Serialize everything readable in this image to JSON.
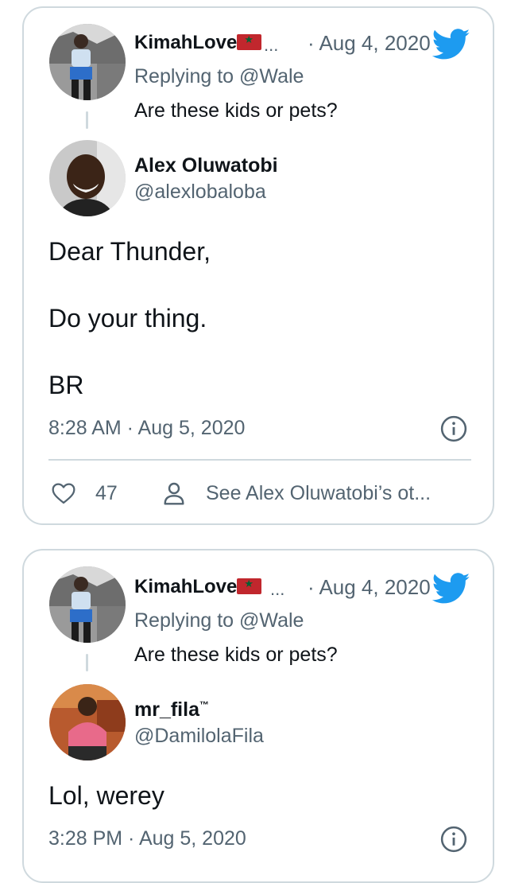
{
  "cards": [
    {
      "parent": {
        "name": "KimahLove",
        "ellipsis": "...",
        "date": "· Aug 4, 2020",
        "replying_prefix": "Replying to ",
        "replying_handle": "@Wale",
        "text": "Are these kids or pets?"
      },
      "author": {
        "name": "Alex Oluwatobi",
        "handle": "@alexlobaloba"
      },
      "body": [
        "Dear Thunder,",
        "Do your thing.",
        "BR"
      ],
      "timestamp": "8:28 AM · Aug 5, 2020",
      "likes": "47",
      "see_more": "See Alex Oluwatobi’s ot..."
    },
    {
      "parent": {
        "name": "KimahLove",
        "ellipsis": "...",
        "date": "· Aug 4, 2020",
        "replying_prefix": "Replying to ",
        "replying_handle": "@Wale",
        "text": "Are these kids or pets?"
      },
      "author": {
        "name": "mr_fila",
        "name_suffix": "™",
        "handle": "@DamilolaFila"
      },
      "body": [
        "Lol, werey"
      ],
      "timestamp": "3:28 PM · Aug 5, 2020"
    }
  ],
  "colors": {
    "twitter_blue": "#1d9bf0",
    "secondary_text": "#536471",
    "border": "#cfd9de",
    "flag_red": "#c1272d"
  },
  "icons": {
    "logo": "twitter-bird-icon",
    "info": "info-icon",
    "like": "heart-icon",
    "profile": "person-icon",
    "flag": "morocco-flag-icon"
  }
}
